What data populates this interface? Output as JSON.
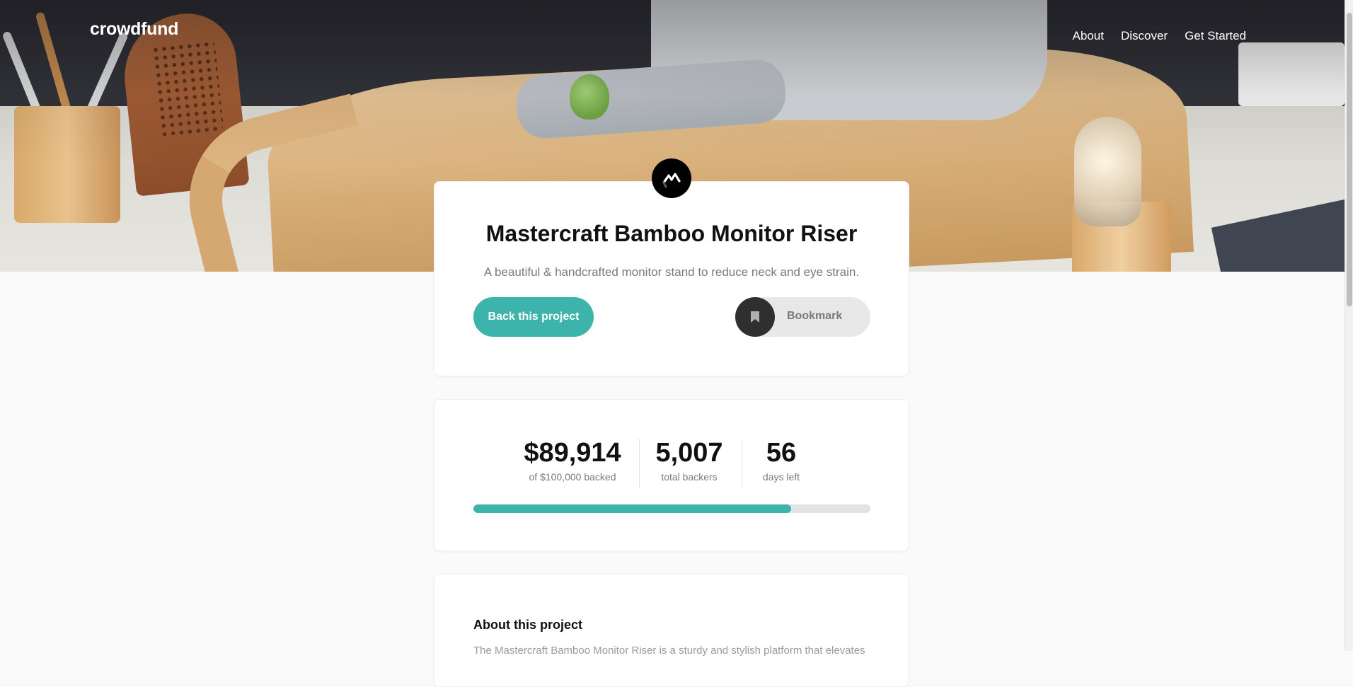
{
  "header": {
    "logo": "crowdfund",
    "nav": [
      "About",
      "Discover",
      "Get Started"
    ]
  },
  "project": {
    "title": "Mastercraft Bamboo Monitor Riser",
    "subtitle": "A beautiful & handcrafted monitor stand to reduce neck and eye strain.",
    "back_label": "Back this project",
    "bookmark_label": "Bookmark"
  },
  "stats": {
    "backed_amount": "$89,914",
    "backed_label": "of $100,000 backed",
    "backers": "5,007",
    "backers_label": "total backers",
    "days_left": "56",
    "days_label": "days left",
    "progress_fraction": 0.8
  },
  "about": {
    "title": "About this project",
    "text": "The Mastercraft Bamboo Monitor Riser is a sturdy and stylish platform that elevates"
  },
  "colors": {
    "accent": "#3cb3ab",
    "dark": "#2f2f2f",
    "muted_text": "#7a7a7a"
  },
  "icons": {
    "brand": "mastercraft-logo-icon",
    "bookmark": "bookmark-icon"
  }
}
